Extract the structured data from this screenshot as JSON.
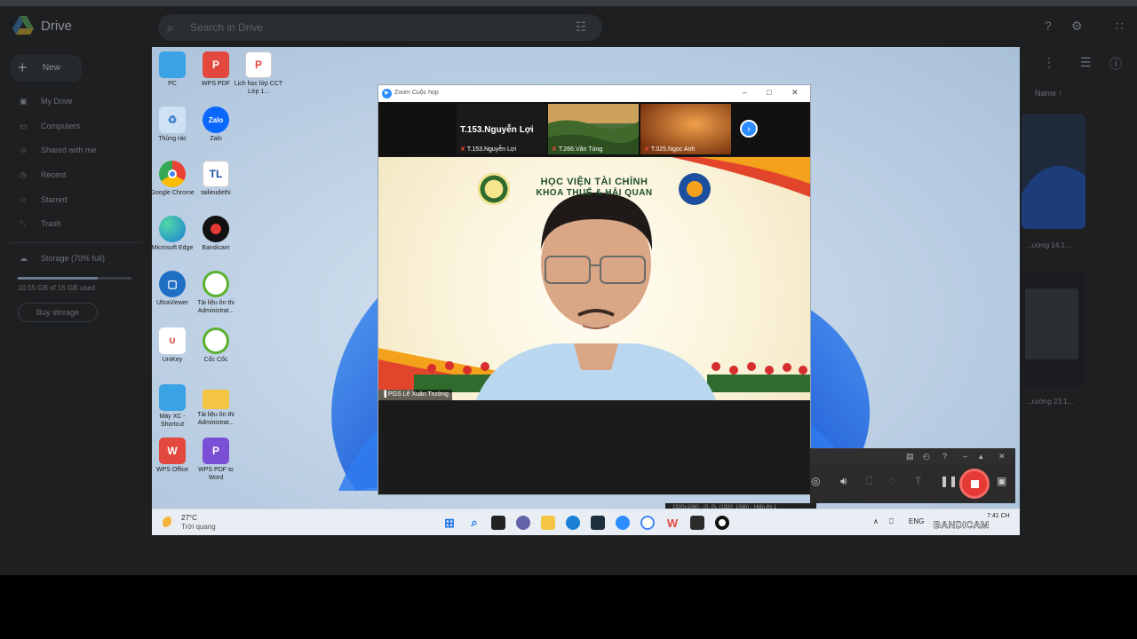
{
  "drive": {
    "app_name": "Drive",
    "search_placeholder": "Search in Drive",
    "new_label": "New",
    "nav": [
      {
        "icon": "my-drive-icon",
        "label": "My Drive"
      },
      {
        "icon": "computers-icon",
        "label": "Computers"
      },
      {
        "icon": "shared-icon",
        "label": "Shared with me"
      },
      {
        "icon": "recent-icon",
        "label": "Recent"
      },
      {
        "icon": "starred-icon",
        "label": "Starred"
      },
      {
        "icon": "trash-icon",
        "label": "Trash"
      }
    ],
    "storage_label": "Storage (70% full)",
    "storage_fraction": 0.7,
    "storage_used": "10.55 GB of 15 GB used",
    "buy_storage": "Buy storage",
    "sort_label": "Name",
    "thumb_labels": [
      "...ường 14.1...",
      "...rường 23.1..."
    ]
  },
  "desktop": {
    "icons": [
      {
        "label": "PC",
        "icon": "pc-icon",
        "color": "#3aa3e6"
      },
      {
        "label": "WPS PDF",
        "icon": "wps-pdf-icon",
        "color": "#e2483d",
        "glyph": "P"
      },
      {
        "label": "Lịch học lớp CCT Lớp 1...",
        "icon": "pdf-file-icon",
        "color": "#ffffff",
        "glyph": "P"
      },
      {
        "label": "Thùng rác",
        "icon": "recycle-bin-icon",
        "color": "#9fc7ea"
      },
      {
        "label": "Zalo",
        "icon": "zalo-icon",
        "color": "#0a68ff",
        "glyph": "Zalo"
      },
      {
        "label": "Google Chrome",
        "icon": "chrome-icon",
        "color": "#ea4335"
      },
      {
        "label": "tailieudethi",
        "icon": "tl-icon",
        "color": "#ffffff",
        "glyph": "TL"
      },
      {
        "label": "Microsoft Edge",
        "icon": "edge-icon",
        "color": "#1a7fd6"
      },
      {
        "label": "Bandicam",
        "icon": "bandicam-icon",
        "color": "#111111"
      },
      {
        "label": "UltraViewer",
        "icon": "ultraviewer-icon",
        "color": "#1f6fc4"
      },
      {
        "label": "Tài liệu ôn thi Administrat...",
        "icon": "coccoc-icon",
        "color": "#5ab031"
      },
      {
        "label": "UniKey",
        "icon": "unikey-icon",
        "color": "#ffffff"
      },
      {
        "label": "Cốc Cốc",
        "icon": "coccoc-browser-icon",
        "color": "#5ab031"
      },
      {
        "label": "Máy XC - Shortcut",
        "icon": "monitor-icon",
        "color": "#3aa3e6"
      },
      {
        "label": "Tài liệu ôn thi Administrat...",
        "icon": "folder-icon",
        "color": "#f4c542"
      },
      {
        "label": "WPS Office",
        "icon": "wps-office-icon",
        "color": "#e2483d",
        "glyph": "W"
      },
      {
        "label": "WPS PDF to Word",
        "icon": "wps-pdf-word-icon",
        "color": "#7a4fd6",
        "glyph": "P"
      }
    ]
  },
  "zoom": {
    "title": "Zoom Cuộc họp",
    "tiles": [
      {
        "name": "T.153.Nguyễn Lợi",
        "caption": "T.153.Nguyễn Lợi"
      },
      {
        "name": "",
        "caption": "T.266.Văn Tùng"
      },
      {
        "name": "",
        "caption": "T.025.Ngọc Anh"
      }
    ],
    "banner_line1": "HỌC VIỆN TÀI CHÍNH",
    "banner_line2": "KHOA THUẾ & HẢI QUAN",
    "speaker": "PGS Lê Xuân Trường"
  },
  "bandicam": {
    "status": "1920x1080 - (0, 0), (1920, 1080) - Hiển thị 1",
    "watermark": "BANDICAM"
  },
  "taskbar": {
    "temperature": "27°C",
    "weather": "Trời quang",
    "language": "ENG",
    "time": "7:41 CH"
  }
}
